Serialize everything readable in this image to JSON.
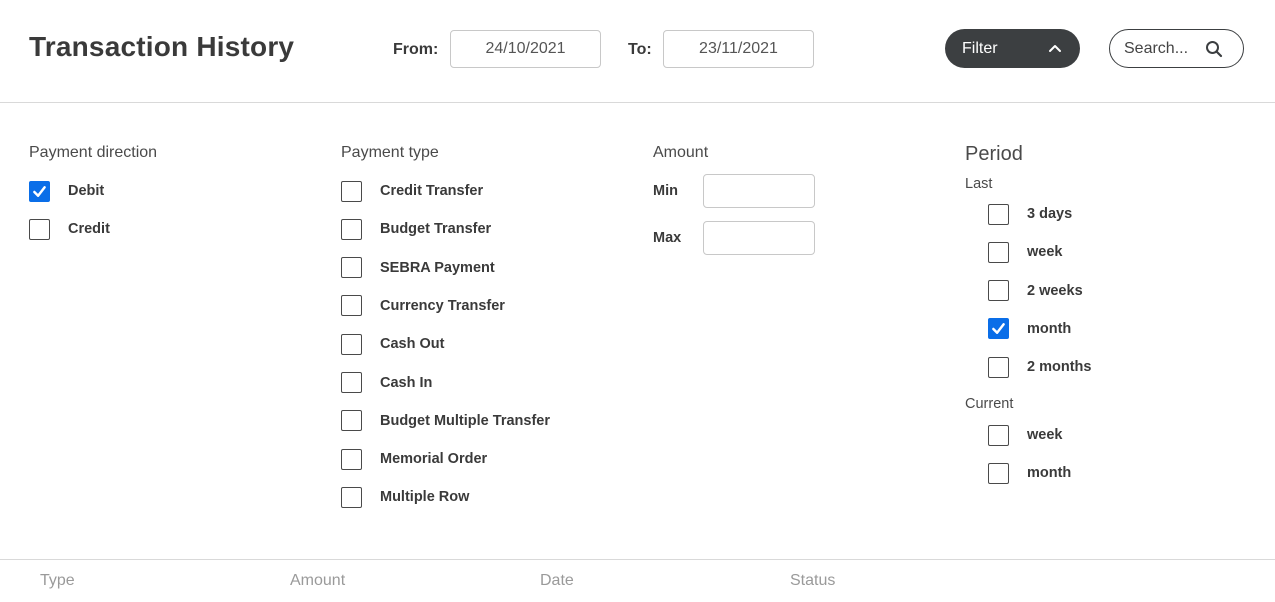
{
  "header": {
    "title": "Transaction History",
    "from_label": "From:",
    "from_value": "24/10/2021",
    "to_label": "To:",
    "to_value": "23/11/2021",
    "filter_label": "Filter",
    "search_label": "Search..."
  },
  "direction": {
    "heading": "Payment direction",
    "items": [
      {
        "label": "Debit",
        "checked": true
      },
      {
        "label": "Credit",
        "checked": false
      }
    ]
  },
  "payment_type": {
    "heading": "Payment type",
    "items": [
      {
        "label": "Credit Transfer",
        "checked": false
      },
      {
        "label": "Budget Transfer",
        "checked": false
      },
      {
        "label": "SEBRA Payment",
        "checked": false
      },
      {
        "label": "Currency Transfer",
        "checked": false
      },
      {
        "label": "Cash Out",
        "checked": false
      },
      {
        "label": "Cash In",
        "checked": false
      },
      {
        "label": "Budget Multiple Transfer",
        "checked": false
      },
      {
        "label": "Memorial Order",
        "checked": false
      },
      {
        "label": "Multiple Row",
        "checked": false
      }
    ]
  },
  "amount": {
    "heading": "Amount",
    "min_label": "Min",
    "min_value": "",
    "max_label": "Max",
    "max_value": ""
  },
  "period": {
    "heading": "Period",
    "last_label": "Last",
    "last_items": [
      {
        "label": "3 days",
        "checked": false
      },
      {
        "label": "week",
        "checked": false
      },
      {
        "label": "2 weeks",
        "checked": false
      },
      {
        "label": "month",
        "checked": true
      },
      {
        "label": "2 months",
        "checked": false
      }
    ],
    "current_label": "Current",
    "current_items": [
      {
        "label": "week",
        "checked": false
      },
      {
        "label": "month",
        "checked": false
      }
    ]
  },
  "table": {
    "columns": [
      "Type",
      "Amount",
      "Date",
      "Status"
    ]
  },
  "colors": {
    "accent": "#0a6ee8",
    "dark_button": "#3c3f41"
  }
}
